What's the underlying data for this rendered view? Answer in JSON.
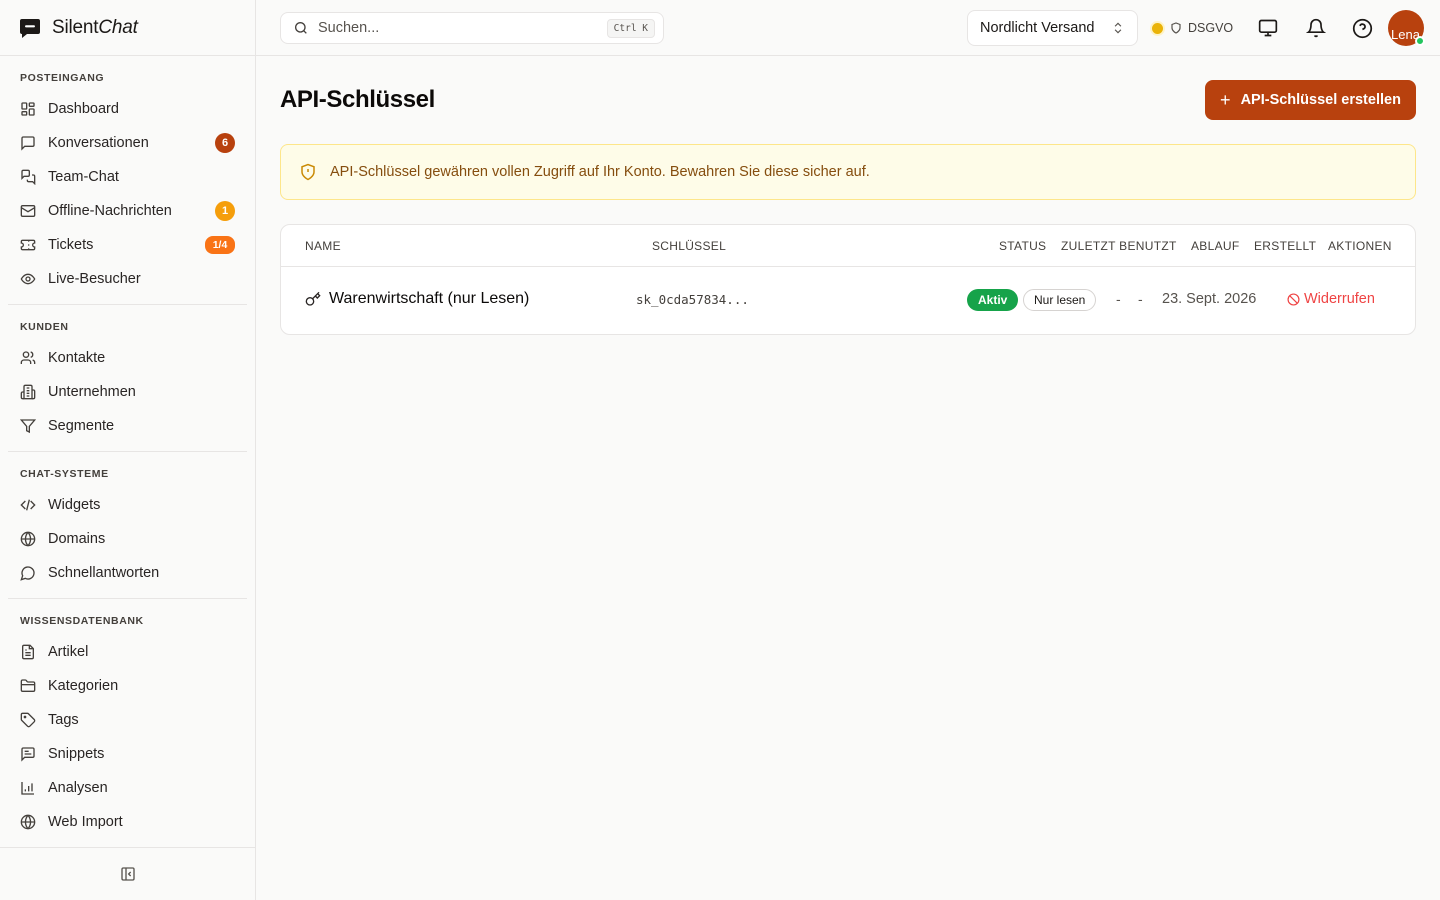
{
  "brand": {
    "name_regular": "Silent",
    "name_italic": "Chat",
    "logo_icon": "chat-bubble-icon"
  },
  "sidebar": {
    "sections": [
      {
        "heading": "POSTEINGANG",
        "items": [
          {
            "label": "Dashboard",
            "icon": "dashboard-icon"
          },
          {
            "label": "Konversationen",
            "icon": "message-square-icon",
            "badge": "6",
            "badge_color": "#b8410e"
          },
          {
            "label": "Team-Chat",
            "icon": "messages-icon"
          },
          {
            "label": "Offline-Nachrichten",
            "icon": "mail-icon",
            "badge": "1",
            "badge_color": "#f59e0b"
          },
          {
            "label": "Tickets",
            "icon": "ticket-icon",
            "badge": "1/4",
            "badge_color": "#f97316"
          },
          {
            "label": "Live-Besucher",
            "icon": "eye-icon"
          }
        ]
      },
      {
        "heading": "KUNDEN",
        "items": [
          {
            "label": "Kontakte",
            "icon": "users-icon"
          },
          {
            "label": "Unternehmen",
            "icon": "building-icon"
          },
          {
            "label": "Segmente",
            "icon": "filter-icon"
          }
        ]
      },
      {
        "heading": "CHAT-SYSTEME",
        "items": [
          {
            "label": "Widgets",
            "icon": "code-icon"
          },
          {
            "label": "Domains",
            "icon": "globe-icon"
          },
          {
            "label": "Schnellantworten",
            "icon": "message-circle-icon"
          }
        ]
      },
      {
        "heading": "WISSENSDATENBANK",
        "items": [
          {
            "label": "Artikel",
            "icon": "file-text-icon"
          },
          {
            "label": "Kategorien",
            "icon": "folder-icon"
          },
          {
            "label": "Tags",
            "icon": "tag-icon"
          },
          {
            "label": "Snippets",
            "icon": "message-lines-icon"
          },
          {
            "label": "Analysen",
            "icon": "bar-chart-icon"
          },
          {
            "label": "Web Import",
            "icon": "globe-icon"
          }
        ]
      }
    ],
    "collapse_icon": "panel-left-close-icon"
  },
  "topbar": {
    "search_placeholder": "Suchen...",
    "search_shortcut": "Ctrl K",
    "organization": "Nordlicht Versand",
    "compliance_label": "DSGVO",
    "compliance_color": "#eab308",
    "avatar_text": "Lena"
  },
  "page": {
    "title": "API-Schlüssel",
    "create_button": "API-Schlüssel erstellen",
    "alert_text": "API-Schlüssel gewähren vollen Zugriff auf Ihr Konto. Bewahren Sie diese sicher auf.",
    "table": {
      "headers": {
        "name": "NAME",
        "key": "SCHLÜSSEL",
        "status": "STATUS",
        "last_used": "ZULETZT BENUTZT",
        "expiry": "ABLAUF",
        "created": "ERSTELLT",
        "actions": "AKTIONEN"
      },
      "rows": [
        {
          "name": "Warenwirtschaft (nur Lesen)",
          "key": "sk_0cda57834...",
          "status": "Aktiv",
          "scope": "Nur lesen",
          "last_used": "-",
          "expiry": "-",
          "created": "23. Sept. 2026",
          "action": "Widerrufen"
        }
      ]
    }
  },
  "colors": {
    "accent": "#b8410e",
    "active_green": "#16a34a",
    "danger": "#ef4444",
    "alert_bg": "#fefce8"
  }
}
